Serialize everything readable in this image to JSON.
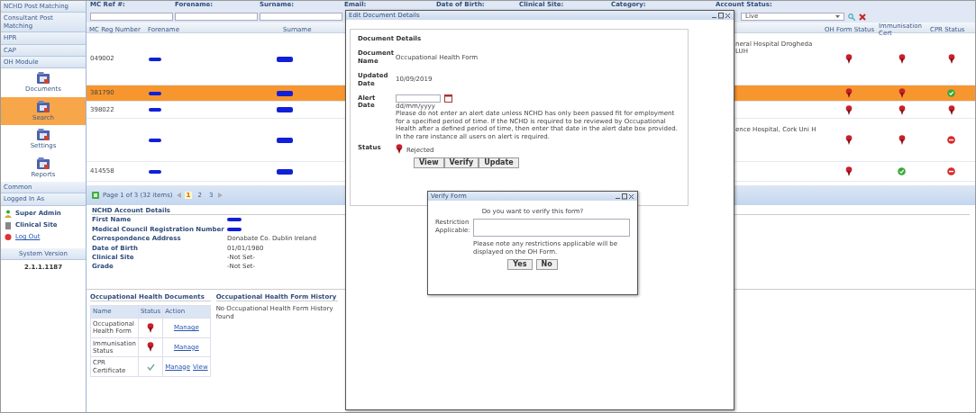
{
  "sidebar": {
    "sections": [
      {
        "label": "NCHD Post Matching"
      },
      {
        "label": "Consultant Post Matching"
      },
      {
        "label": "HPR"
      },
      {
        "label": "CAP"
      },
      {
        "label": "OH Module"
      }
    ],
    "modules": [
      {
        "label": "Documents",
        "selected": false
      },
      {
        "label": "Search",
        "selected": true
      },
      {
        "label": "Settings",
        "selected": false
      },
      {
        "label": "Reports",
        "selected": false
      }
    ],
    "common": "Common",
    "logged_in_header": "Logged In As",
    "user_name": "Super Admin",
    "user_role": "Clinical Site",
    "logout": "Log Out",
    "version_header": "System Version",
    "version": "2.1.1.1187"
  },
  "filters": [
    {
      "label": "MC Ref #:"
    },
    {
      "label": "Forename:"
    },
    {
      "label": "Surname:"
    },
    {
      "label": "Email:"
    },
    {
      "label": "Date of Birth:"
    },
    {
      "label": "Clinical Site:"
    },
    {
      "label": "Category:"
    },
    {
      "label": "Account Status:"
    }
  ],
  "account_status": {
    "value": "Live"
  },
  "grid": {
    "columns": [
      "MC Reg Number",
      "Forename",
      "Surname",
      "OH Form Status",
      "Immunisation Cert",
      "CPR Status"
    ],
    "rows": [
      {
        "mc_reg_number": "049002",
        "clinical_site": "neral Hospital Drogheda LUH",
        "statuses": [
          {
            "kind": "pin"
          },
          {
            "kind": "pin"
          },
          {
            "kind": "pin"
          }
        ],
        "selected": false
      },
      {
        "mc_reg_number": "381790",
        "statuses": [
          {
            "kind": "pin"
          },
          {
            "kind": "pin"
          },
          {
            "kind": "ok"
          }
        ],
        "selected": true
      },
      {
        "mc_reg_number": "398022",
        "statuses": [
          {
            "kind": "pin"
          },
          {
            "kind": "pin"
          },
          {
            "kind": "pin"
          }
        ],
        "selected": false
      },
      {
        "clinical_site": "ence Hospital, Cork Uni H",
        "statuses": [
          {
            "kind": "pin"
          },
          {
            "kind": "pin"
          },
          {
            "kind": "no"
          }
        ],
        "selected": false
      },
      {
        "mc_reg_number": "414558",
        "statuses": [
          {
            "kind": "pin"
          },
          {
            "kind": "ok"
          },
          {
            "kind": "no"
          }
        ],
        "selected": false
      }
    ]
  },
  "pager": {
    "text": "Page 1 of 3 (32 items)",
    "pages": [
      {
        "label": "1",
        "selected": true
      },
      {
        "label": "2",
        "selected": false
      },
      {
        "label": "3",
        "selected": false
      }
    ]
  },
  "account_details": {
    "title": "NCHD Account Details",
    "fields": [
      {
        "label": "First Name",
        "redacted": true
      },
      {
        "label": "Medical Council Registration Number",
        "redacted": true
      },
      {
        "label": "Correspondence Address",
        "value": "Donabate Co. Dublin Ireland"
      },
      {
        "label": "Date of Birth",
        "value": "01/01/1980"
      },
      {
        "label": "Clinical Site",
        "value": "-Not Set-"
      },
      {
        "label": "Grade",
        "value": "-Not Set-"
      }
    ]
  },
  "oh_documents": {
    "title": "Occupational Health Documents",
    "columns": [
      "Name",
      "Status",
      "Action"
    ],
    "rows": [
      {
        "name": "Occupational Health Form",
        "kind": "pin",
        "actions": [
          "Manage"
        ]
      },
      {
        "name": "Immunisation Status",
        "kind": "pin",
        "actions": [
          "Manage"
        ]
      },
      {
        "name": "CPR Certificate",
        "kind": "tick",
        "actions": [
          "Manage",
          "View"
        ]
      }
    ]
  },
  "oh_history": {
    "title": "Occupational Health Form History",
    "empty_text": "No Occupational Health Form History found"
  },
  "edit_dialog": {
    "title": "Edit Document Details",
    "legend": "Document Details",
    "document_name_label": "Document Name",
    "document_name": "Occupational Health Form",
    "updated_date_label": "Updated Date",
    "updated_date": "10/09/2019",
    "alert_date_label": "Alert Date",
    "date_format": "dd/mm/yyyy",
    "alert_note": "Please do not enter an alert date unless NCHD has only been passed fit for employment for a specified period of time. If the NCHD is required to be reviewed by Occupational Health after a defined period of time, then enter that date in the alert date box provided. In the rare instance all users on alert is required.",
    "status_label": "Status",
    "status": {
      "kind": "pin",
      "text": "Rejected"
    },
    "buttons": [
      "View",
      "Verify",
      "Update"
    ]
  },
  "verify_dialog": {
    "title": "Verify Form",
    "question": "Do you want to verify this form?",
    "restriction_label": "Restriction Applicable:",
    "note": "Please note any restrictions applicable will be displayed on the OH Form.",
    "buttons": [
      "Yes",
      "No"
    ]
  }
}
